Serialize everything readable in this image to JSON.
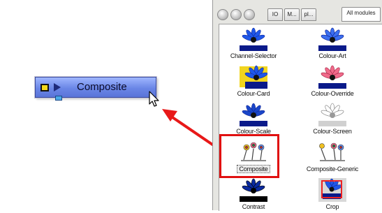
{
  "node": {
    "label": "Composite"
  },
  "panel": {
    "toolbar": [
      "",
      "",
      ""
    ],
    "tabs": [
      {
        "label": "IO",
        "active": false
      },
      {
        "label": "M...",
        "active": false
      },
      {
        "label": "pl...",
        "active": false
      },
      {
        "label": "All modules",
        "active": true
      }
    ],
    "modules": [
      {
        "label": "Channel-Selector",
        "icon": "blue-flower-icon"
      },
      {
        "label": "Colour-Art",
        "icon": "blue-flower-icon"
      },
      {
        "label": "Colour-Card",
        "icon": "yellow-card-flower-icon"
      },
      {
        "label": "Colour-Override",
        "icon": "pink-flower-icon"
      },
      {
        "label": "Colour-Scale",
        "icon": "blue-flower-icon"
      },
      {
        "label": "Colour-Screen",
        "icon": "grey-flower-icon"
      },
      {
        "label": "Composite",
        "icon": "composite-flowers-icon",
        "selected": true
      },
      {
        "label": "Composite-Generic",
        "icon": "composite-generic-icon"
      },
      {
        "label": "Contrast",
        "icon": "dark-flower-icon"
      },
      {
        "label": "Crop",
        "icon": "crop-flower-icon"
      }
    ]
  },
  "colors": {
    "node_blue": "#6a86e6",
    "highlight_red": "#e01010",
    "arrow_red": "#e81818"
  }
}
